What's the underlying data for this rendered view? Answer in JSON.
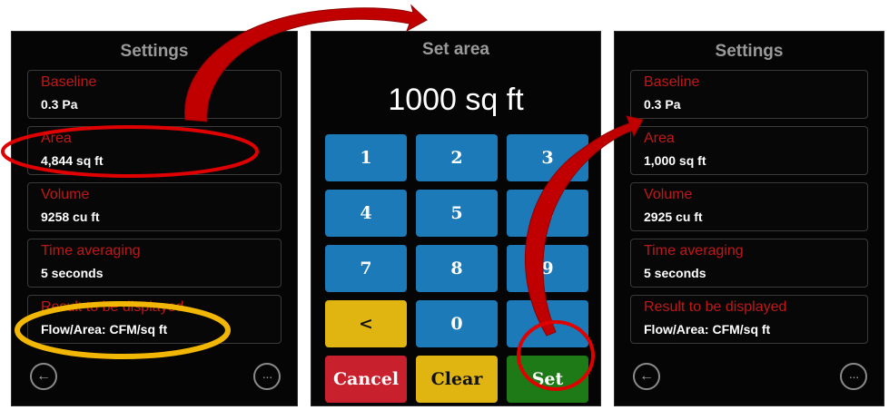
{
  "left_panel": {
    "title": "Settings",
    "rows": [
      {
        "label": "Baseline",
        "value": "0.3 Pa"
      },
      {
        "label": "Area",
        "value": "4,844 sq ft"
      },
      {
        "label": "Volume",
        "value": "9258 cu ft"
      },
      {
        "label": "Time averaging",
        "value": "5 seconds"
      },
      {
        "label": "Result to be displayed",
        "value": "Flow/Area: CFM/sq ft"
      }
    ],
    "back_glyph": "←",
    "more_glyph": "···"
  },
  "middle_panel": {
    "title": "Set area",
    "display_value": "1000 sq ft",
    "keys": [
      "1",
      "2",
      "3",
      "4",
      "5",
      "6",
      "7",
      "8",
      "9",
      "<",
      "0",
      "",
      "Cancel",
      "Clear",
      "Set"
    ]
  },
  "right_panel": {
    "title": "Settings",
    "rows": [
      {
        "label": "Baseline",
        "value": "0.3 Pa"
      },
      {
        "label": "Area",
        "value": "1,000 sq ft"
      },
      {
        "label": "Volume",
        "value": "2925 cu ft"
      },
      {
        "label": "Time averaging",
        "value": "5 seconds"
      },
      {
        "label": "Result to be displayed",
        "value": "Flow/Area: CFM/sq ft"
      }
    ],
    "back_glyph": "←",
    "more_glyph": "···"
  },
  "annotations": {
    "arrow_color": "#c00000",
    "highlight_red": "#e00000",
    "highlight_yellow": "#f2b705"
  }
}
